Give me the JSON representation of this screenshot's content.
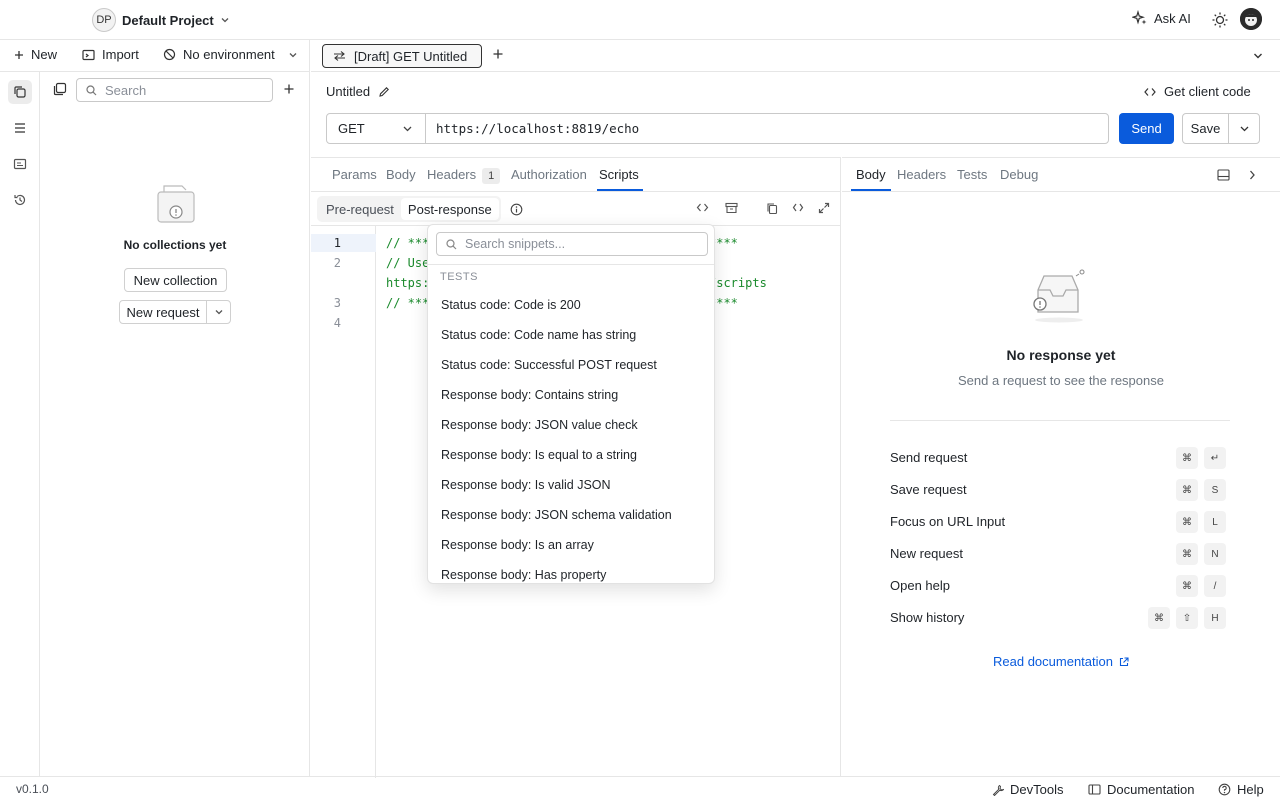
{
  "app": {
    "project_initials": "DP",
    "project_name": "Default Project",
    "ask_ai": "Ask AI"
  },
  "toolbar": {
    "new_label": "New",
    "import_label": "Import",
    "environment_label": "No environment"
  },
  "request_tab": {
    "label": "[Draft] GET Untitled"
  },
  "sidebar": {
    "search_placeholder": "Search",
    "empty_text": "No collections yet",
    "new_collection": "New collection",
    "new_request": "New request"
  },
  "request": {
    "title": "Untitled",
    "client_code": "Get client code",
    "method": "GET",
    "url": "https://localhost:8819/echo",
    "send": "Send",
    "save": "Save"
  },
  "req_tabs": [
    {
      "label": "Params"
    },
    {
      "label": "Body"
    },
    {
      "label": "Headers",
      "badge": "1"
    },
    {
      "label": "Authorization"
    },
    {
      "label": "Scripts",
      "active": true
    }
  ],
  "script_tabs": {
    "pre": "Pre-request",
    "post": "Post-response"
  },
  "editor": {
    "line_numbers": [
      "1",
      "2",
      "3",
      "4"
    ],
    "lines": [
      "// ***",
      "// Use",
      "https:",
      "// ***"
    ],
    "line_tails": [
      "****",
      "",
      "/scripts",
      "****"
    ]
  },
  "snippets": {
    "search_placeholder": "Search snippets...",
    "group": "TESTS",
    "items": [
      "Status code: Code is 200",
      "Status code: Code name has string",
      "Status code: Successful POST request",
      "Response body: Contains string",
      "Response body: JSON value check",
      "Response body: Is equal to a string",
      "Response body: Is valid JSON",
      "Response body: JSON schema validation",
      "Response body: Is an array",
      "Response body: Has property"
    ]
  },
  "res_tabs": [
    {
      "label": "Body",
      "active": true
    },
    {
      "label": "Headers"
    },
    {
      "label": "Tests"
    },
    {
      "label": "Debug"
    }
  ],
  "response": {
    "empty_title": "No response yet",
    "empty_sub": "Send a request to see the response",
    "shortcuts": [
      {
        "label": "Send request",
        "keys": [
          "⌘",
          "↵"
        ]
      },
      {
        "label": "Save request",
        "keys": [
          "⌘",
          "S"
        ]
      },
      {
        "label": "Focus on URL Input",
        "keys": [
          "⌘",
          "L"
        ]
      },
      {
        "label": "New request",
        "keys": [
          "⌘",
          "N"
        ]
      },
      {
        "label": "Open help",
        "keys": [
          "⌘",
          "/"
        ]
      },
      {
        "label": "Show history",
        "keys": [
          "⌘",
          "⇧",
          "H"
        ]
      }
    ],
    "read_docs": "Read documentation"
  },
  "statusbar": {
    "version": "v0.1.0",
    "devtools": "DevTools",
    "documentation": "Documentation",
    "help": "Help"
  },
  "colors": {
    "accent": "#0a5bdc",
    "code_comment": "#1a8a2c"
  }
}
